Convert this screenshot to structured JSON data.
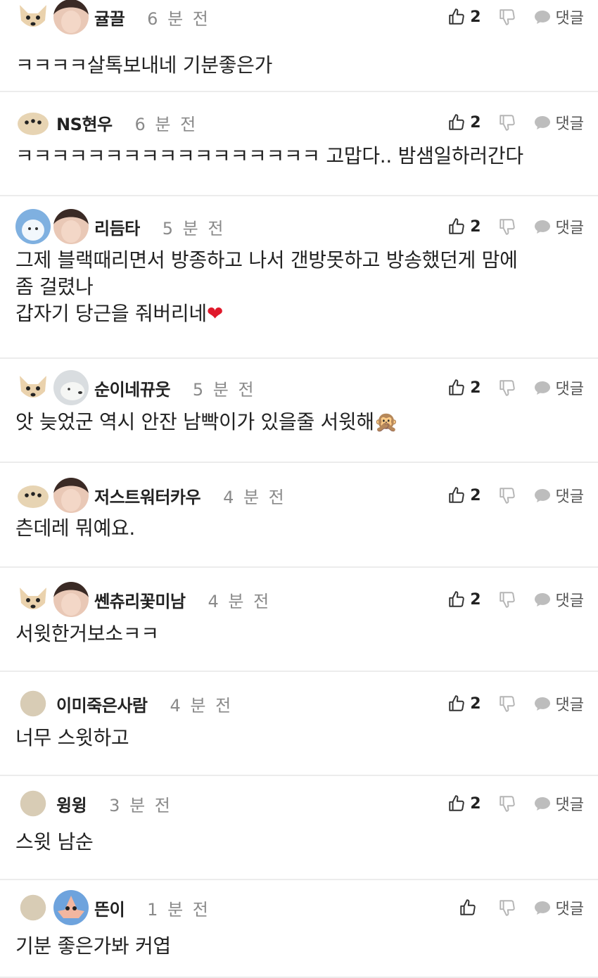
{
  "reply_label": "댓글",
  "comments": [
    {
      "name": "귤끌",
      "time": "6 분 전",
      "likes": "2",
      "text": "ㅋㅋㅋㅋ살톡보내네 기분좋은가"
    },
    {
      "name": "NS현우",
      "time": "6 분 전",
      "likes": "2",
      "text": "ㅋㅋㅋㅋㅋㅋㅋㅋㅋㅋㅋㅋㅋㅋㅋㅋㅋ 고맙다.. 밤샘일하러간다"
    },
    {
      "name": "리듬타",
      "time": "5 분 전",
      "likes": "2",
      "text": "그제 블랙때리면서 방종하고 나서 갠방못하고 방송했던게 맘에\n좀 걸렸나\n갑자기 당근을 줘버리네",
      "emoji": "❤"
    },
    {
      "name": "순이네뀨웃",
      "time": "5 분 전",
      "likes": "2",
      "text": "앗 늦었군 역시 안잔 남빡이가 있을줄 서윗해",
      "emoji": "🙊"
    },
    {
      "name": "저스트워터카우",
      "time": "4 분 전",
      "likes": "2",
      "text": "츤데레 뭐예요."
    },
    {
      "name": "쎈츄리꽃미남",
      "time": "4 분 전",
      "likes": "2",
      "text": "서윗한거보소ㅋㅋ"
    },
    {
      "name": "이미죽은사람",
      "time": "4 분 전",
      "likes": "2",
      "text": "너무 스윗하고"
    },
    {
      "name": "윙윙",
      "time": "3 분 전",
      "likes": "2",
      "text": "스윗 남순"
    },
    {
      "name": "뜬이",
      "time": "1 분 전",
      "likes": "",
      "text": "기분 좋은가봐 커엽"
    }
  ]
}
